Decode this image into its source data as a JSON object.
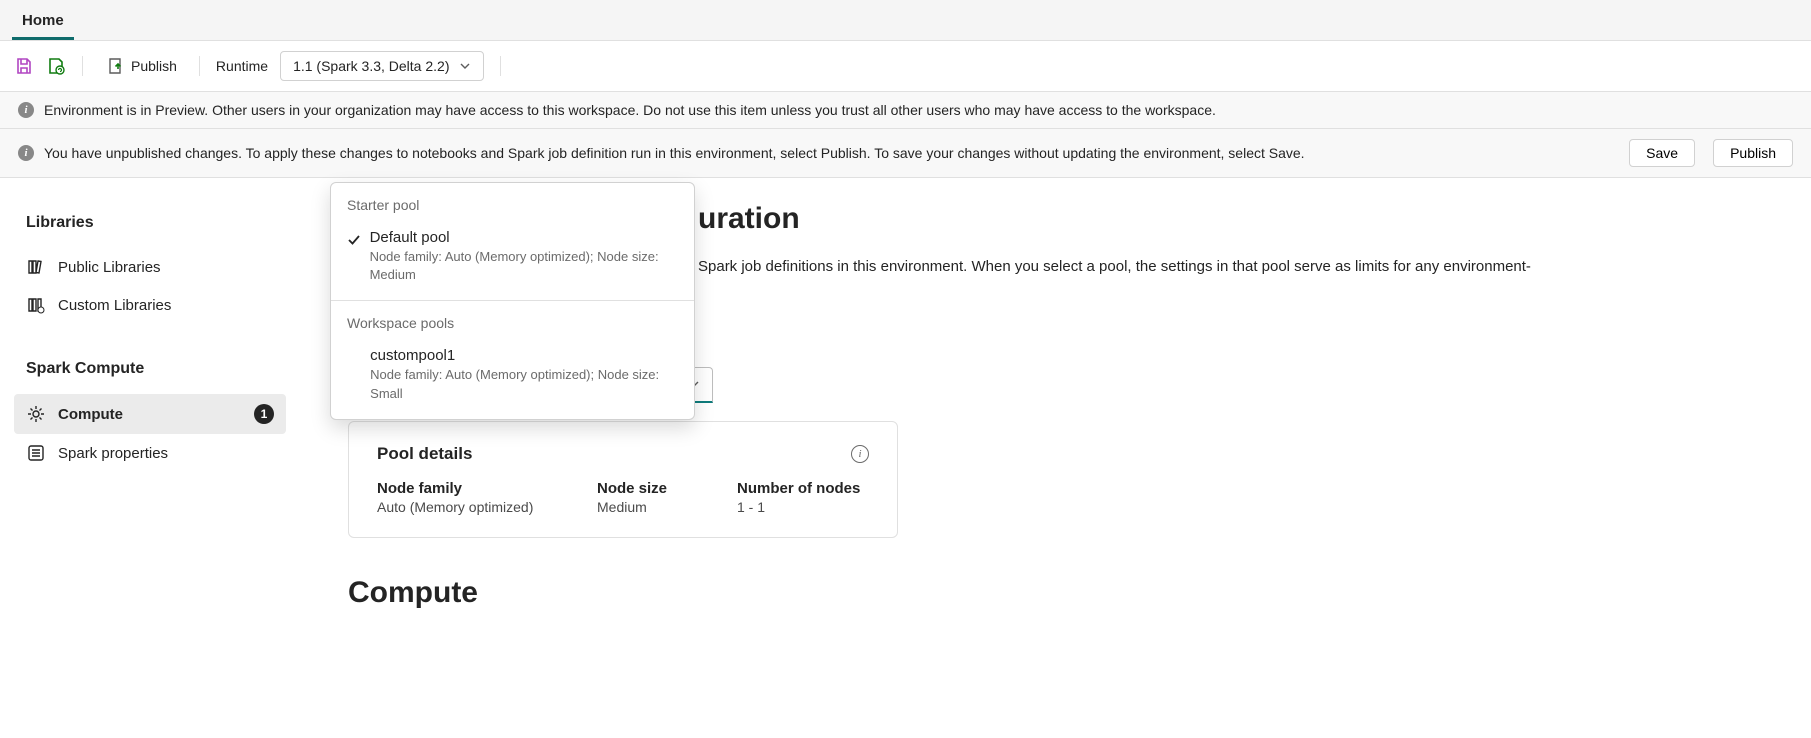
{
  "top_tab": "Home",
  "toolbar": {
    "publish": "Publish",
    "runtime_label": "Runtime",
    "runtime_value": "1.1 (Spark 3.3, Delta 2.2)"
  },
  "banners": {
    "preview": "Environment is in Preview. Other users in your organization may have access to this workspace. Do not use this item unless you trust all other users who may have access to the workspace.",
    "unpublished": "You have unpublished changes. To apply these changes to notebooks and Spark job definition run in this environment, select Publish. To save your changes without updating the environment, select Save.",
    "save_btn": "Save",
    "publish_btn": "Publish"
  },
  "sidebar": {
    "libraries_heading": "Libraries",
    "public_libraries": "Public Libraries",
    "custom_libraries": "Custom Libraries",
    "spark_compute_heading": "Spark Compute",
    "compute": "Compute",
    "compute_badge": "1",
    "spark_properties": "Spark properties"
  },
  "content": {
    "heading_visible_fragment": "uration",
    "desc_visible_fragment": "Spark job definitions in this environment. When you select a pool, the settings in that pool serve as limits for any environment-"
  },
  "pool_combo": {
    "value": "Default pool"
  },
  "flyout": {
    "starter_label": "Starter pool",
    "starter_item_title": "Default pool",
    "starter_item_sub": "Node family: Auto (Memory optimized); Node size: Medium",
    "workspace_label": "Workspace pools",
    "workspace_item_title": "custompool1",
    "workspace_item_sub": "Node family: Auto (Memory optimized); Node size: Small"
  },
  "pool_details": {
    "title": "Pool details",
    "node_family_k": "Node family",
    "node_family_v": "Auto (Memory optimized)",
    "node_size_k": "Node size",
    "node_size_v": "Medium",
    "num_nodes_k": "Number of nodes",
    "num_nodes_v": "1 - 1"
  },
  "compute_heading": "Compute"
}
